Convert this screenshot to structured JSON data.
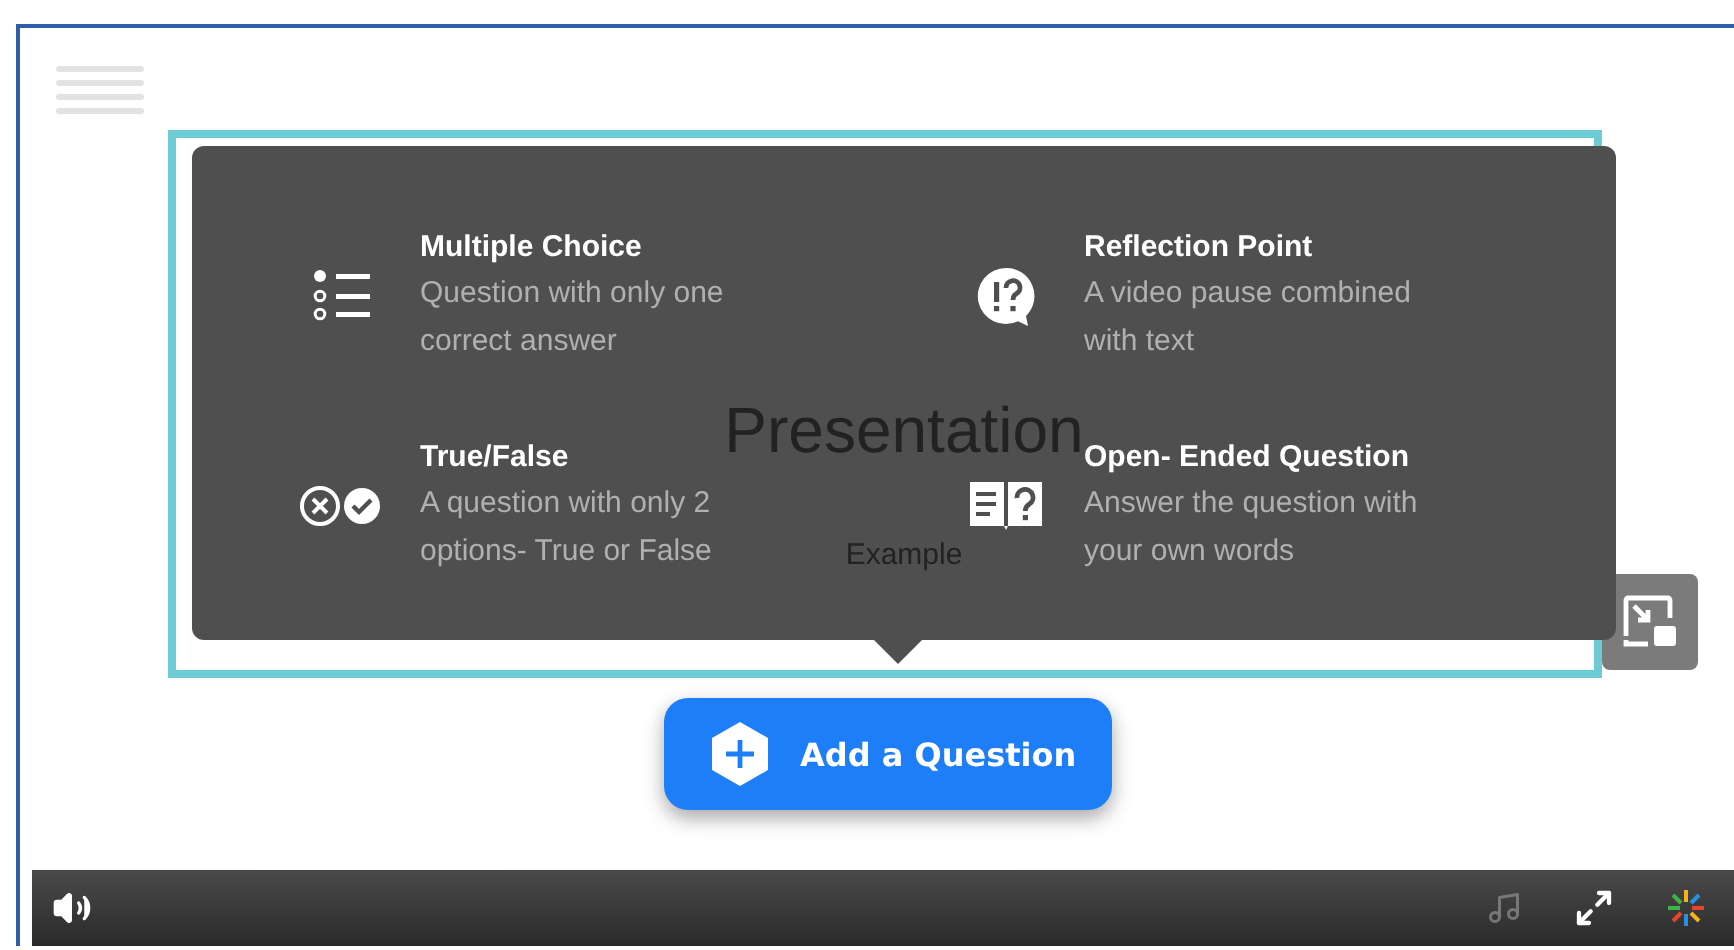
{
  "slide": {
    "title": "Presentation",
    "subtitle": "Example"
  },
  "question_types": [
    {
      "kind": "multiple",
      "title": "Multiple Choice",
      "description": "Question with only one correct answer"
    },
    {
      "kind": "reflection",
      "title": "Reflection Point",
      "description": "A video pause combined with text"
    },
    {
      "kind": "truefalse",
      "title": "True/False",
      "description": "A question with only 2 options- True or False"
    },
    {
      "kind": "open",
      "title": "Open- Ended Question",
      "description": "Answer the question with your own words"
    }
  ],
  "add_button": {
    "label": "Add a Question"
  }
}
